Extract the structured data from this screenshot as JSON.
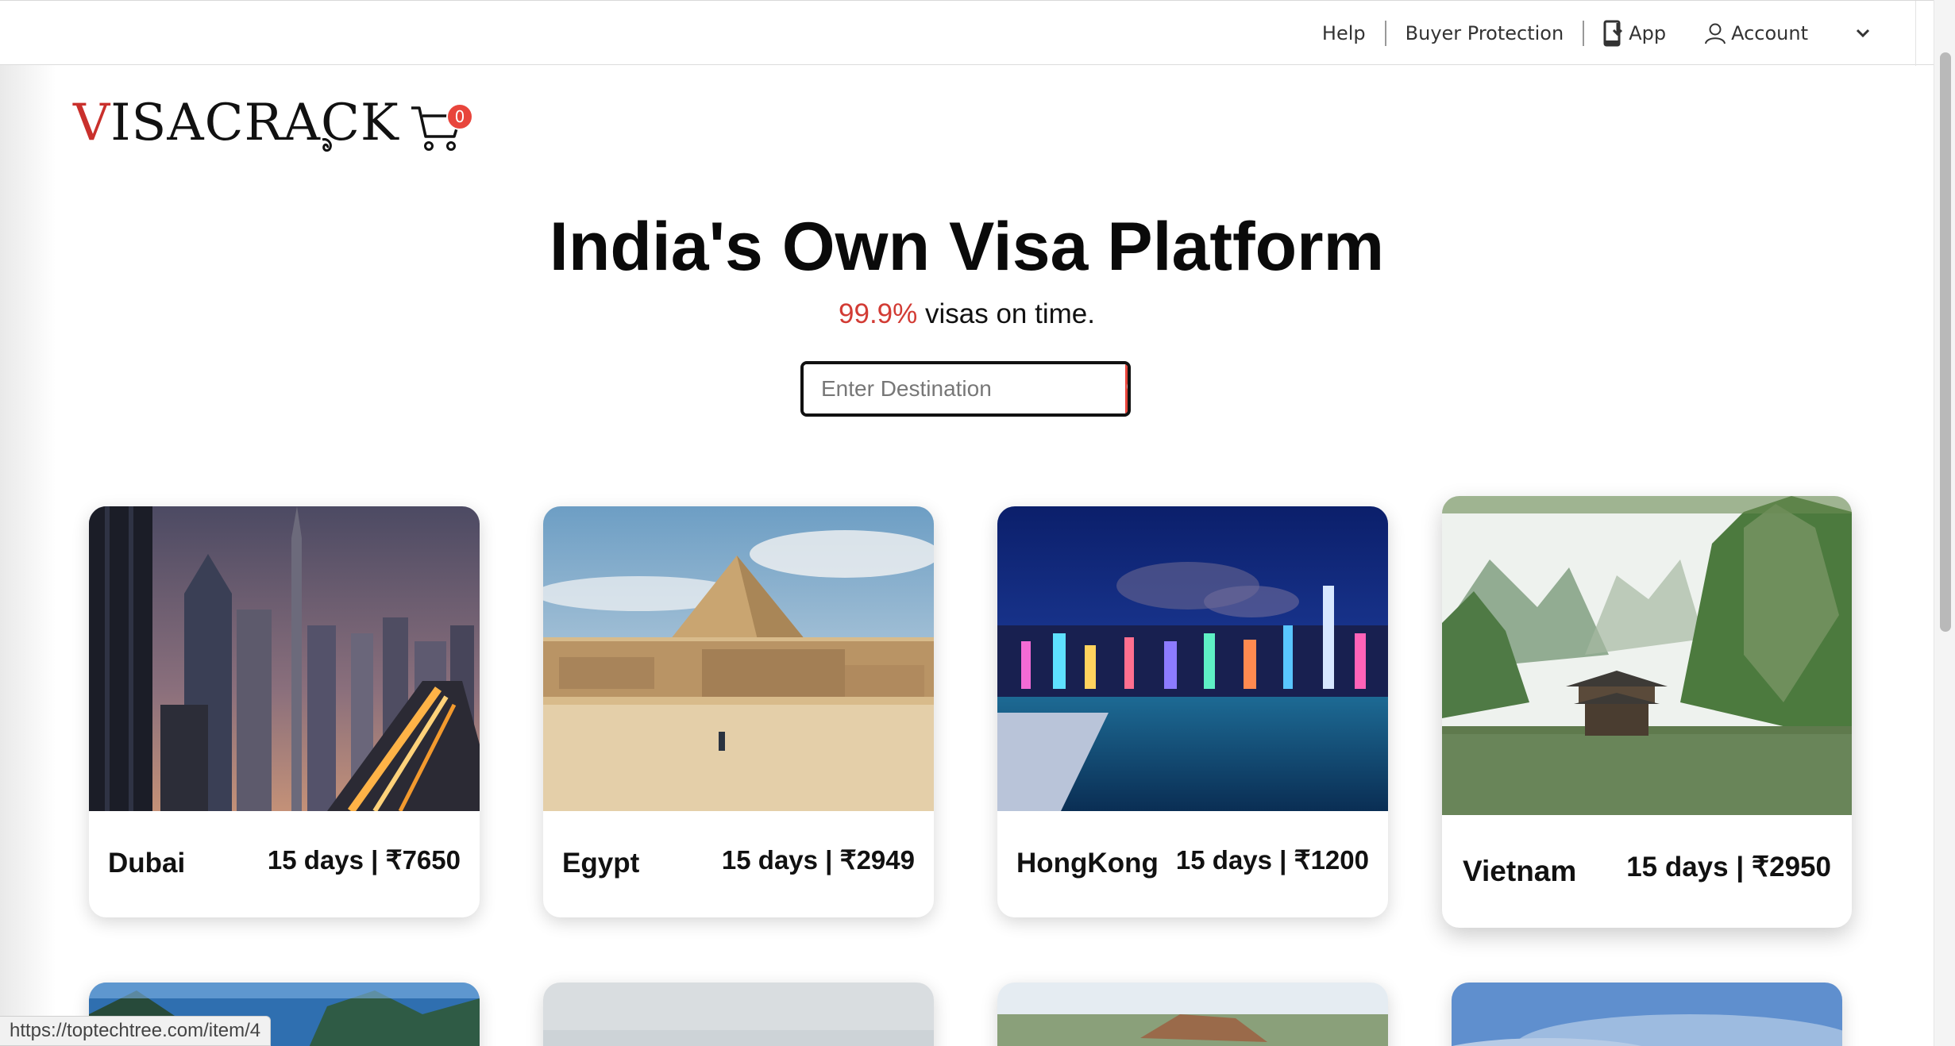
{
  "topnav": {
    "help": "Help",
    "buyer_protection": "Buyer Protection",
    "app": "App",
    "account": "Account"
  },
  "logo": {
    "first_letter": "V",
    "rest": "ISACRACK"
  },
  "cart": {
    "count": "0"
  },
  "hero": {
    "title": "India's Own Visa Platform",
    "accent": "99.9%",
    "subtitle_rest": " visas on time."
  },
  "search": {
    "placeholder": "Enter Destination"
  },
  "destinations": [
    {
      "name": "Dubai",
      "price": "15 days | ₹7650"
    },
    {
      "name": "Egypt",
      "price": "15 days | ₹2949"
    },
    {
      "name": "HongKong",
      "price": "15 days | ₹1200"
    },
    {
      "name": "Vietnam",
      "price": "15 days | ₹2950"
    }
  ],
  "status_url": "https://toptechtree.com/item/4",
  "colors": {
    "accent": "#e8453c",
    "text": "#111111"
  }
}
